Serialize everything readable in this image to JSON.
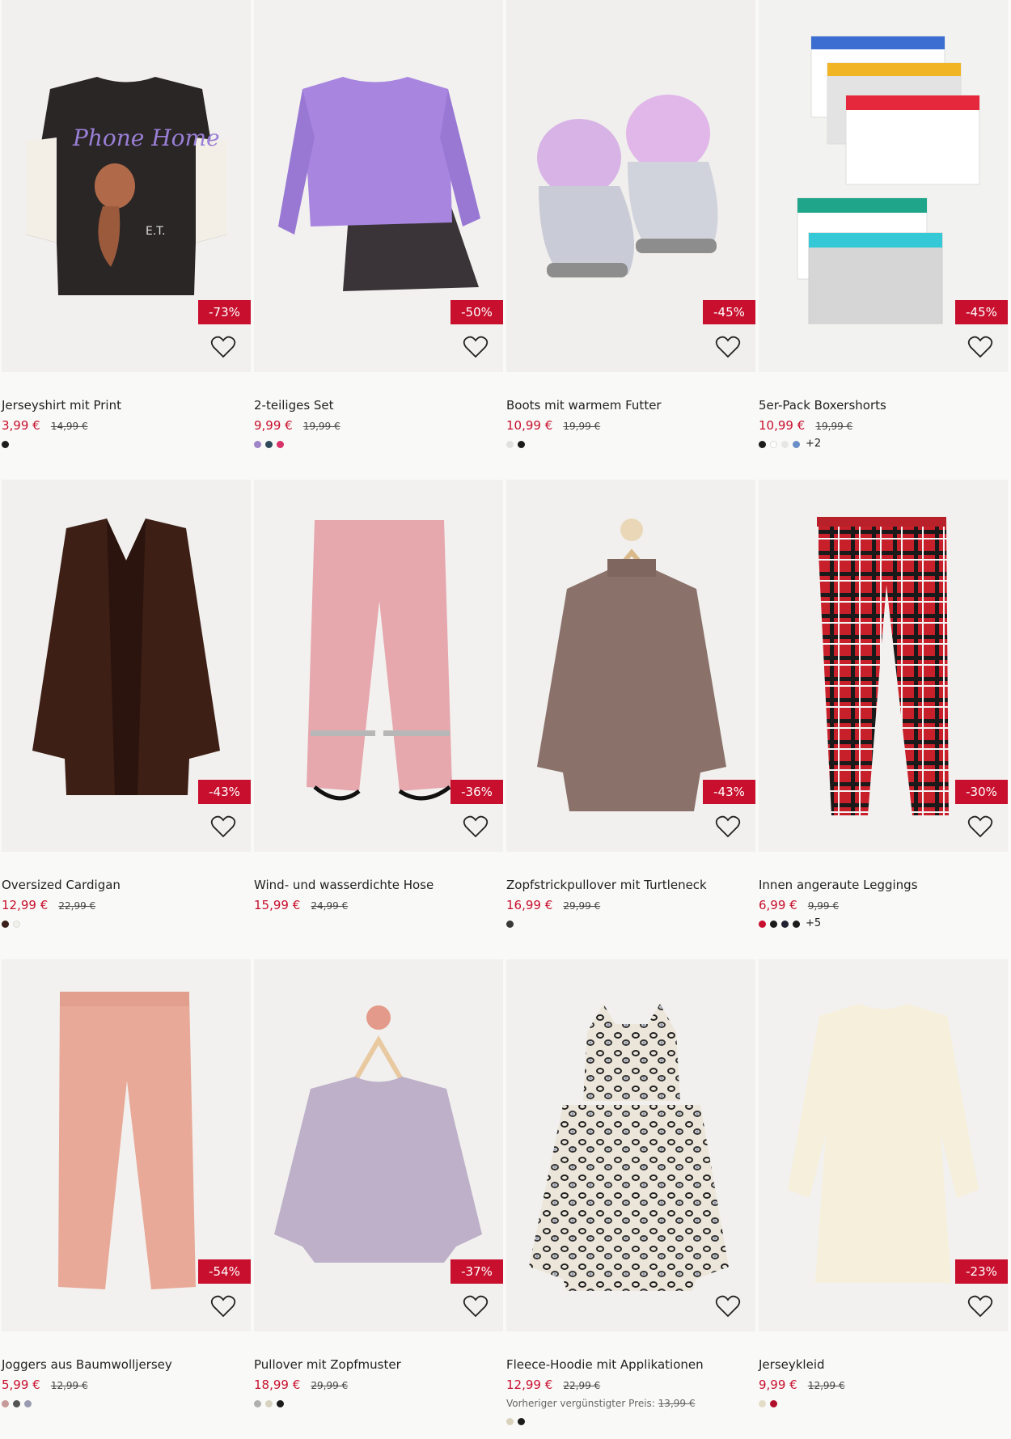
{
  "products": [
    {
      "name": "Jerseyshirt mit Print",
      "price": "3,99 €",
      "old_price": "14,99 €",
      "discount": "-73%",
      "swatches": [
        "#1c1c1c"
      ],
      "more": ""
    },
    {
      "name": "2-teiliges Set",
      "price": "9,99 €",
      "old_price": "19,99 €",
      "discount": "-50%",
      "swatches": [
        "#9f86c8",
        "#2f4a5a",
        "#d8336a"
      ],
      "more": ""
    },
    {
      "name": "Boots mit warmem Futter",
      "price": "10,99 €",
      "old_price": "19,99 €",
      "discount": "-45%",
      "swatches": [
        "#e1e1e1",
        "#1c1c1c"
      ],
      "more": ""
    },
    {
      "name": "5er-Pack Boxershorts",
      "price": "10,99 €",
      "old_price": "19,99 €",
      "discount": "-45%",
      "swatches": [
        "#1c1c1c",
        "#ffffff",
        "#e6e6e6",
        "#6a8fc8"
      ],
      "more": "+2"
    },
    {
      "name": "Oversized Cardigan",
      "price": "12,99 €",
      "old_price": "22,99 €",
      "discount": "-43%",
      "swatches": [
        "#3a2018",
        "#f1f1ea"
      ],
      "more": ""
    },
    {
      "name": "Wind- und wasserdichte Hose",
      "price": "15,99 €",
      "old_price": "24,99 €",
      "discount": "-36%",
      "swatches": [],
      "more": ""
    },
    {
      "name": "Zopfstrickpullover mit Turtleneck",
      "price": "16,99 €",
      "old_price": "29,99 €",
      "discount": "-43%",
      "swatches": [
        "#3a3a3a"
      ],
      "more": ""
    },
    {
      "name": "Innen angeraute Leggings",
      "price": "6,99 €",
      "old_price": "9,99 €",
      "discount": "-30%",
      "swatches": [
        "#c8102e",
        "#1c1c1c",
        "#222233",
        "#1c1c1c"
      ],
      "more": "+5"
    },
    {
      "name": "Joggers aus Baumwolljersey",
      "price": "5,99 €",
      "old_price": "12,99 €",
      "discount": "-54%",
      "swatches": [
        "#c79a9a",
        "#555555",
        "#9a9ab0"
      ],
      "more": ""
    },
    {
      "name": "Pullover mit Zopfmuster",
      "price": "18,99 €",
      "old_price": "29,99 €",
      "discount": "-37%",
      "swatches": [
        "#b0b0b0",
        "#d8d3c0",
        "#1c1c1c"
      ],
      "more": ""
    },
    {
      "name": "Fleece-Hoodie mit Applikationen",
      "price": "12,99 €",
      "old_price": "22,99 €",
      "discount": "",
      "swatches": [
        "#d9d2bd",
        "#1c1c1c"
      ],
      "more": "",
      "prev_label": "Vorheriger vergünstigter Preis:",
      "prev_price": "13,99 €"
    },
    {
      "name": "Jerseykleid",
      "price": "9,99 €",
      "old_price": "12,99 €",
      "discount": "-23%",
      "swatches": [
        "#e3ddc8",
        "#b0102a"
      ],
      "more": ""
    }
  ]
}
